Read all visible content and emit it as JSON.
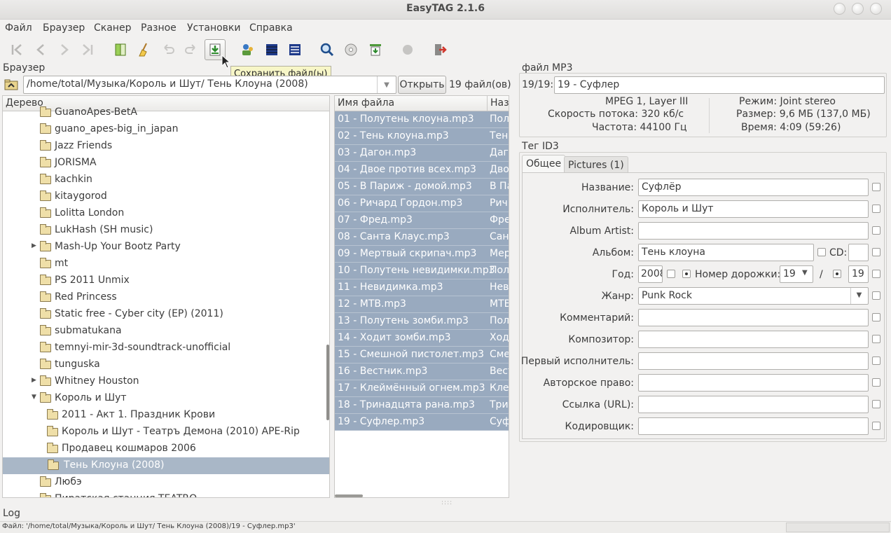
{
  "window": {
    "title": "EasyTAG 2.1.6"
  },
  "menu": [
    "Файл",
    "Браузер",
    "Сканер",
    "Разное",
    "Установки",
    "Справка"
  ],
  "toolbar": {
    "tooltip": "Сохранить файл(ы)",
    "icons": [
      "first-file-icon",
      "prev-file-icon",
      "next-file-icon",
      "last-file-icon",
      "scan-icon",
      "clear-icon",
      "undo-icon",
      "redo-icon",
      "save-file-icon",
      "select-all-icon",
      "invert-selection-icon",
      "view-list-icon",
      "search-icon",
      "cd-icon",
      "playlist-icon",
      "record-icon",
      "exit-icon"
    ]
  },
  "browser": {
    "label": "Браузер",
    "path": "/home/total/Музыка/Король и Шут/ Тень Клоуна (2008)",
    "open_button": "Открыть",
    "file_count": "19 файл(ов)"
  },
  "tree": {
    "header": "Дерево",
    "items": [
      {
        "label": "GuanoApes-BetA",
        "indent": 1,
        "expander": ""
      },
      {
        "label": "guano_apes-big_in_japan",
        "indent": 1,
        "expander": ""
      },
      {
        "label": "Jazz Friends",
        "indent": 1,
        "expander": ""
      },
      {
        "label": "JORISMA",
        "indent": 1,
        "expander": ""
      },
      {
        "label": "kachkin",
        "indent": 1,
        "expander": ""
      },
      {
        "label": "kitaygorod",
        "indent": 1,
        "expander": ""
      },
      {
        "label": "Lolitta London",
        "indent": 1,
        "expander": ""
      },
      {
        "label": "LukHash (SH music)",
        "indent": 1,
        "expander": ""
      },
      {
        "label": "Mash-Up Your Bootz Party",
        "indent": 1,
        "expander": "▶"
      },
      {
        "label": "mt",
        "indent": 1,
        "expander": ""
      },
      {
        "label": "PS 2011 Unmix",
        "indent": 1,
        "expander": ""
      },
      {
        "label": "Red Princess",
        "indent": 1,
        "expander": ""
      },
      {
        "label": "Static free - Cyber city (EP) (2011)",
        "indent": 1,
        "expander": ""
      },
      {
        "label": "submatukana",
        "indent": 1,
        "expander": ""
      },
      {
        "label": "temnyi-mir-3d-soundtrack-unofficial",
        "indent": 1,
        "expander": ""
      },
      {
        "label": "tunguska",
        "indent": 1,
        "expander": ""
      },
      {
        "label": "Whitney Houston",
        "indent": 1,
        "expander": "▶"
      },
      {
        "label": "Король и Шут",
        "indent": 1,
        "expander": "▼"
      },
      {
        "label": "2011 - Акт 1. Праздник Крови",
        "indent": 2,
        "expander": ""
      },
      {
        "label": "Король и Шут - Театръ Демона (2010) APE-Rip",
        "indent": 2,
        "expander": ""
      },
      {
        "label": "Продавец кошмаров 2006",
        "indent": 2,
        "expander": ""
      },
      {
        "label": "Тень Клоуна (2008)",
        "indent": 2,
        "expander": "",
        "selected": true
      },
      {
        "label": "Любэ",
        "indent": 1,
        "expander": ""
      },
      {
        "label": "Пиратская станция TEATRO",
        "indent": 1,
        "expander": ""
      }
    ]
  },
  "files": {
    "col_filename": "Имя файла",
    "col_title": "Назв",
    "rows": [
      {
        "file": "01 - Полутень клоуна.mp3",
        "title": "Пол"
      },
      {
        "file": "02 - Тень клоуна.mp3",
        "title": "Тень"
      },
      {
        "file": "03 - Дагон.mp3",
        "title": "Даго"
      },
      {
        "file": "04 - Двое против всех.mp3",
        "title": "Дво"
      },
      {
        "file": "05 - В Париж - домой.mp3",
        "title": "В Па"
      },
      {
        "file": "06 - Ричард Гордон.mp3",
        "title": "Рич"
      },
      {
        "file": "07 - Фред.mp3",
        "title": "Фре"
      },
      {
        "file": "08 - Санта Клаус.mp3",
        "title": "Сант"
      },
      {
        "file": "09 - Мертвый скрипач.mp3",
        "title": "Мер"
      },
      {
        "file": "10 - Полутень невидимки.mp3",
        "title": "Пол"
      },
      {
        "file": "11 - Невидимка.mp3",
        "title": "Нев"
      },
      {
        "file": "12 - МТВ.mp3",
        "title": "МТВ"
      },
      {
        "file": "13 - Полутень зомби.mp3",
        "title": "Пол"
      },
      {
        "file": "14 - Ходит зомби.mp3",
        "title": "Ход"
      },
      {
        "file": "15 - Смешной пистолет.mp3",
        "title": "Сме"
      },
      {
        "file": "16 - Вестник.mp3",
        "title": "Вест"
      },
      {
        "file": "17 - Клеймённый огнем.mp3",
        "title": "Кле"
      },
      {
        "file": "18 - Тринадцята рана.mp3",
        "title": "Три"
      },
      {
        "file": "19 - Суфлер.mp3",
        "title": "Суф"
      }
    ]
  },
  "fileinfo": {
    "label": "файл MP3",
    "counter": "19/19:",
    "current": "19 - Суфлер",
    "format": "MPEG 1, Layer III",
    "bitrate": "Скорость потока: 320 кб/с",
    "frequency": "Частота: 44100 Гц",
    "mode": "Режим: Joint stereo",
    "size": "Размер: 9,6 МБ (137,0 МБ)",
    "time": "Время: 4:09 (59:26)"
  },
  "tag": {
    "label": "Тег ID3",
    "tabs": [
      "Общее",
      "Pictures (1)"
    ],
    "title_label": "Название:",
    "title": "Суфлёр",
    "artist_label": "Исполнитель:",
    "artist": "Король и Шут",
    "album_artist_label": "Album Artist:",
    "album_artist": "",
    "album_label": "Альбом:",
    "album": "Тень клоуна",
    "cd_label": "CD:",
    "cd": "",
    "year_label": "Год:",
    "year": "2008",
    "track_label": "Номер дорожки:",
    "track": "19",
    "track_sep": "/",
    "track_total": "19",
    "genre_label": "Жанр:",
    "genre": "Punk Rock",
    "comment_label": "Комментарий:",
    "comment": "",
    "composer_label": "Композитор:",
    "composer": "",
    "orig_artist_label": "Первый исполнитель:",
    "orig_artist": "",
    "copyright_label": "Авторское право:",
    "copyright": "",
    "url_label": "Ссылка (URL):",
    "url": "",
    "encoder_label": "Кодировщик:",
    "encoder": ""
  },
  "log": {
    "label": "Log"
  },
  "status": "Файл: '/home/total/Музыка/Король и Шут/ Тень Клоуна (2008)/19 - Суфлер.mp3'"
}
